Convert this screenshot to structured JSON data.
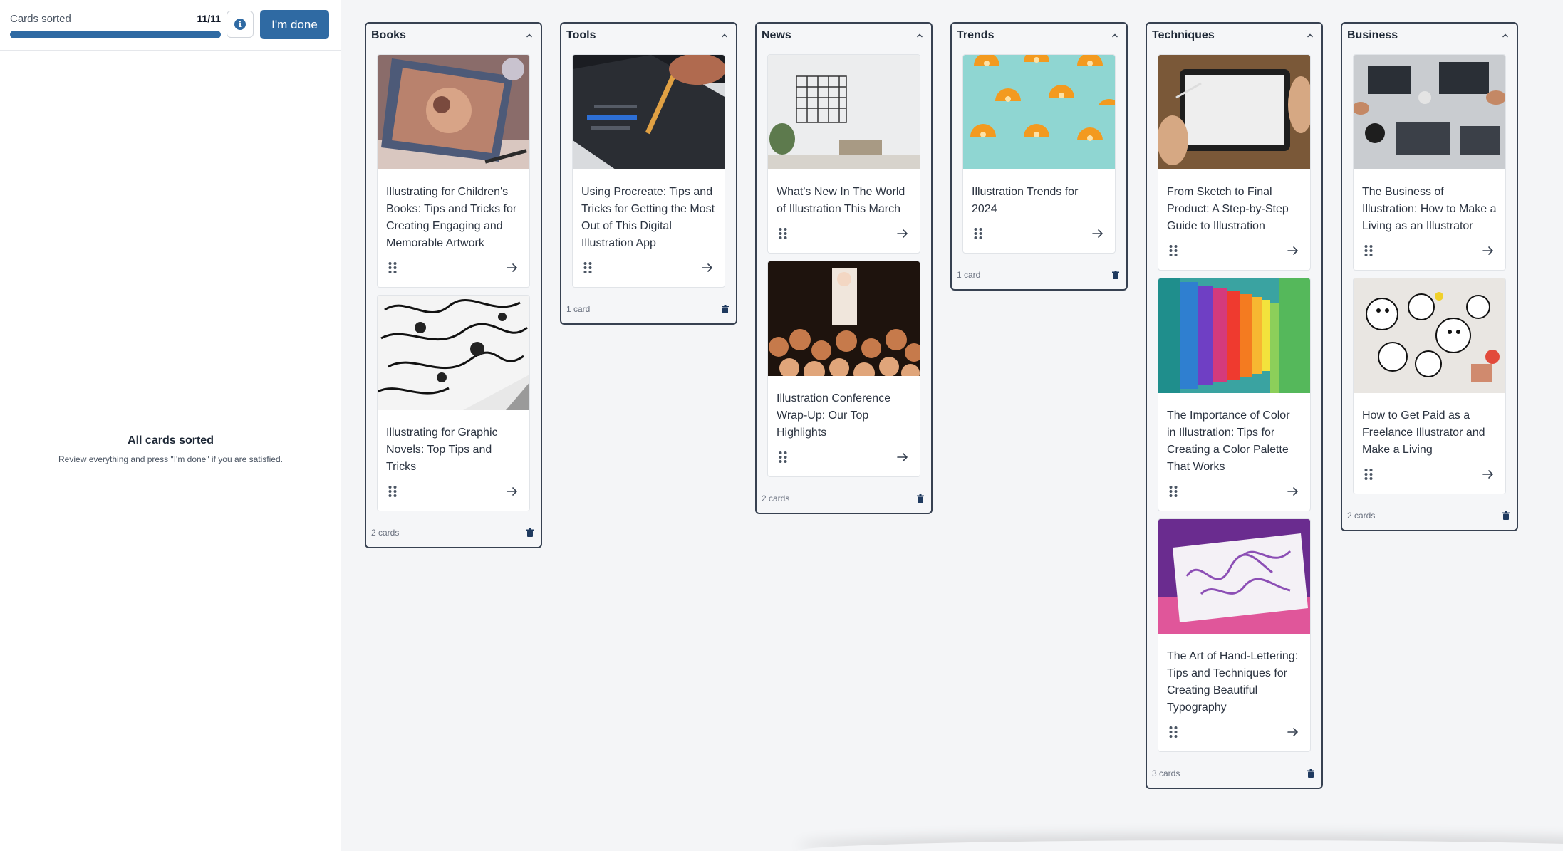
{
  "progress": {
    "label": "Cards sorted",
    "count": "11/11",
    "fraction": 1.0
  },
  "done_button": "I'm done",
  "empty_state": {
    "title": "All cards sorted",
    "subtitle": "Review everything and press \"I'm done\" if you are satisfied."
  },
  "colors": {
    "accent": "#2f6aa3",
    "column_border": "#374151",
    "background": "#f4f5f7"
  },
  "icons": {
    "info": "info-icon",
    "collapse": "chevron-up-icon",
    "drag": "drag-handle-icon",
    "open": "arrow-right-icon",
    "delete": "trash-icon"
  },
  "columns": [
    {
      "title": "Books",
      "count": "2 cards",
      "cards": [
        {
          "title": "Illustrating for Children's Books: Tips and Tricks for Creating Engaging and Memorable Artwork",
          "image": "sketchbook-illustration-photo"
        },
        {
          "title": "Illustrating for Graphic Novels: Top Tips and Tricks",
          "image": "ink-comic-drawing-photo"
        }
      ]
    },
    {
      "title": "Tools",
      "count": "1 card",
      "cards": [
        {
          "title": "Using Procreate: Tips and Tricks for Getting the Most Out of This Digital Illustration App",
          "image": "tablet-stylus-photo"
        }
      ]
    },
    {
      "title": "News",
      "count": "2 cards",
      "cards": [
        {
          "title": "What's New In The World of Illustration This March",
          "image": "desk-with-wall-art-photo"
        },
        {
          "title": "Illustration Conference Wrap-Up: Our Top Highlights",
          "image": "conference-crowd-photo"
        }
      ]
    },
    {
      "title": "Trends",
      "count": "1 card",
      "cards": [
        {
          "title": "Illustration Trends for 2024",
          "image": "orange-slices-pattern-photo"
        }
      ]
    },
    {
      "title": "Techniques",
      "count": "3 cards",
      "cards": [
        {
          "title": "From Sketch to Final Product: A Step-by-Step Guide to Illustration",
          "image": "drawing-tablet-hands-photo"
        },
        {
          "title": "The Importance of Color in Illustration: Tips for Creating a Color Palette That Works",
          "image": "rainbow-tunnel-photo"
        },
        {
          "title": "The Art of Hand-Lettering: Tips and Techniques for Creating Beautiful Typography",
          "image": "hand-lettering-card-photo"
        }
      ]
    },
    {
      "title": "Business",
      "count": "2 cards",
      "cards": [
        {
          "title": "The Business of Illustration: How to Make a Living as an Illustrator",
          "image": "team-desk-laptops-photo"
        },
        {
          "title": "How to Get Paid as a Freelance Illustrator and Make a Living",
          "image": "doodle-stickers-photo"
        }
      ]
    }
  ]
}
